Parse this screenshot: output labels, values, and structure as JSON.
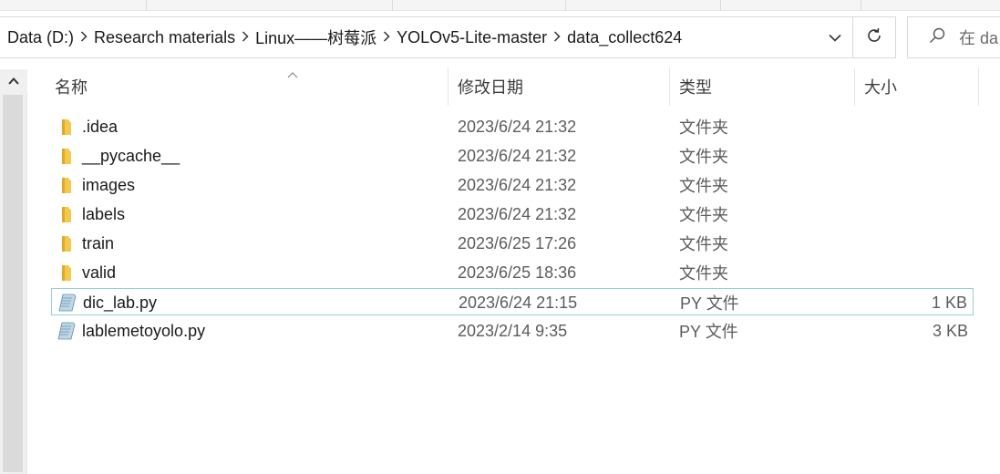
{
  "address": {
    "crumbs": [
      "Data (D:)",
      "Research materials",
      "Linux——树莓派",
      "YOLOv5-Lite-master",
      "data_collect624"
    ]
  },
  "search": {
    "placeholder": "在 da"
  },
  "columns": {
    "name": "名称",
    "date": "修改日期",
    "type": "类型",
    "size": "大小"
  },
  "files": [
    {
      "name": ".idea",
      "date": "2023/6/24 21:32",
      "type": "文件夹",
      "size": "",
      "icon": "folder-icon"
    },
    {
      "name": "__pycache__",
      "date": "2023/6/24 21:32",
      "type": "文件夹",
      "size": "",
      "icon": "folder-icon"
    },
    {
      "name": "images",
      "date": "2023/6/24 21:32",
      "type": "文件夹",
      "size": "",
      "icon": "folder-icon"
    },
    {
      "name": "labels",
      "date": "2023/6/24 21:32",
      "type": "文件夹",
      "size": "",
      "icon": "folder-icon"
    },
    {
      "name": "train",
      "date": "2023/6/25 17:26",
      "type": "文件夹",
      "size": "",
      "icon": "folder-icon"
    },
    {
      "name": "valid",
      "date": "2023/6/25 18:36",
      "type": "文件夹",
      "size": "",
      "icon": "folder-icon"
    },
    {
      "name": "dic_lab.py",
      "date": "2023/6/24 21:15",
      "type": "PY 文件",
      "size": "1 KB",
      "icon": "python-file-icon",
      "selected": true
    },
    {
      "name": "lablemetoyolo.py",
      "date": "2023/2/14 9:35",
      "type": "PY 文件",
      "size": "3 KB",
      "icon": "python-file-icon"
    }
  ],
  "colors": {
    "folder": "#f2c94c",
    "selection_border": "#99d1d1",
    "text_secondary": "#5c5c5c"
  }
}
